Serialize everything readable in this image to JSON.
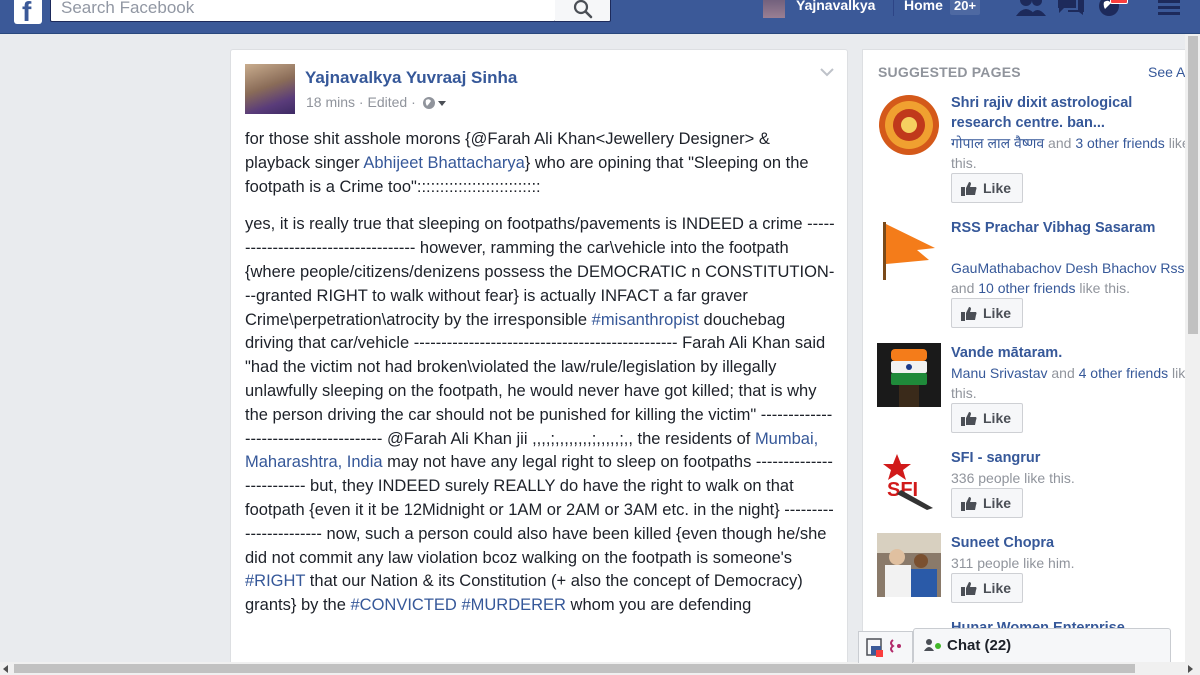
{
  "header": {
    "search_placeholder": "Search Facebook",
    "user_name": "Yajnavalkya",
    "home_label": "Home",
    "home_count": "20+",
    "brand_color": "#3b5998"
  },
  "post": {
    "author": "Yajnavalkya Yuvraaj Sinha",
    "time": "18 mins",
    "edited": "Edited",
    "p1": {
      "a": "for those shit asshole morons {@Farah Ali Khan<Jewellery Designer> & playback singer ",
      "link": "Abhijeet Bhattacharya",
      "b": "} who are opining that \"Sleeping on the footpath is a Crime too\":::::::::::::::::::::::::::"
    },
    "p2": {
      "a": "yes, it is really true that sleeping on footpaths/pavements is INDEED a crime ------------------------------------ however, ramming the car\\vehicle into the footpath {where people/citizens/denizens possess the DEMOCRATIC n CONSTITUTION---granted RIGHT to walk without fear} is actually INFACT a far graver Crime\\perpetration\\atrocity by the irresponsible ",
      "tag1": "#misanthropist",
      "b": " douchebag driving that car/vehicle ------------------------------------------------ Farah Ali Khan said \"had the victim not had broken\\violated the law/rule/legislation by illegally unlawfully sleeping on the footpath, he would never have got killed; that is why the person driving the car should not be punished for killing the victim\" -------------------------------------- @Farah Ali Khan jii ,,,,;,,,,,,,,;,,,,,;,, the residents of ",
      "location": "Mumbai, Maharashtra, India",
      "c": " may not have any legal right to sleep on footpaths ------------------------- but, they INDEED surely REALLY do have the right to walk on that footpath {even it it be 12Midnight or 1AM or 2AM or 3AM etc. in the night} ----------------------- now, such a person could also have been killed {even though he/she did not commit any law violation bcoz walking on the footpath is someone's ",
      "tag2": "#RIGHT",
      "d": " that our Nation & its Constitution (+ also the concept of Democracy) grants} by the ",
      "tag3": "#CONVICTED",
      "e": " ",
      "tag4": "#MURDERER",
      "f": " whom you are defending"
    }
  },
  "suggested": {
    "title": "SUGGESTED PAGES",
    "see_all": "See A",
    "like_label": "Like",
    "items": [
      {
        "name": "Shri rajiv dixit astrological research centre. ban...",
        "friend": "गोपाल लाल वैष्णव",
        "and": " and ",
        "others": "3 other friends",
        "tail": " like this."
      },
      {
        "name": "RSS Prachar Vibhag Sasaram",
        "friend": "GauMathabachov Desh Bhachov Rss",
        "and": " and ",
        "others": "10 other friends",
        "tail": " like this."
      },
      {
        "name": "Vande mātaram.",
        "friend": "Manu Srivastav",
        "and": " and ",
        "others": "4 other friends",
        "tail": " like this."
      },
      {
        "name": "SFI - sangrur",
        "stat": "336 people like this."
      },
      {
        "name": "Suneet Chopra",
        "stat": "311 people like him."
      },
      {
        "name": "Hunar Women Enterprise"
      }
    ]
  },
  "chat": {
    "label": "Chat (22)"
  }
}
